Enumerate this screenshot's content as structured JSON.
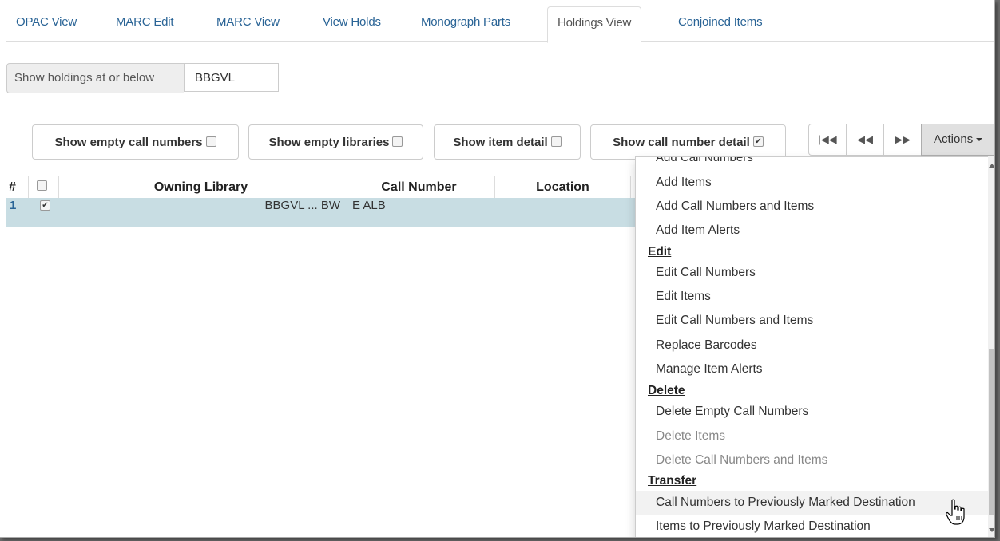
{
  "tabs": [
    {
      "label": "OPAC View"
    },
    {
      "label": "MARC Edit"
    },
    {
      "label": "MARC View"
    },
    {
      "label": "View Holds"
    },
    {
      "label": "Monograph Parts"
    },
    {
      "label": "Holdings View",
      "active": true
    },
    {
      "label": "Conjoined Items"
    }
  ],
  "holdings_filter": {
    "label": "Show holdings at or below",
    "value": "BBGVL"
  },
  "toggles": [
    {
      "label": "Show empty call numbers",
      "checked": false
    },
    {
      "label": "Show empty libraries",
      "checked": false
    },
    {
      "label": "Show item detail",
      "checked": false
    },
    {
      "label": "Show call number detail",
      "checked": true
    }
  ],
  "pager": {
    "first_icon": "first-page-icon",
    "prev_icon": "previous-page-icon",
    "next_icon": "next-page-icon",
    "actions_label": "Actions"
  },
  "grid": {
    "columns": [
      "#",
      "Owning Library",
      "Call Number",
      "Location"
    ],
    "rows": [
      {
        "num": "1",
        "checked": true,
        "owning_library": "BBGVL ... BW",
        "call_number": "E ALB",
        "location": ""
      }
    ]
  },
  "menu": {
    "partial_top": "Add Call Numbers",
    "add_items": [
      "Add Items",
      "Add Call Numbers and Items",
      "Add Item Alerts"
    ],
    "edit_header": "Edit",
    "edit_items": [
      "Edit Call Numbers",
      "Edit Items",
      "Edit Call Numbers and Items",
      "Replace Barcodes",
      "Manage Item Alerts"
    ],
    "delete_header": "Delete",
    "delete_items": [
      "Delete Empty Call Numbers",
      "Delete Items",
      "Delete Call Numbers and Items"
    ],
    "transfer_header": "Transfer",
    "transfer_items": [
      "Call Numbers to Previously Marked Destination",
      "Items to Previously Marked Destination"
    ]
  },
  "colors": {
    "link": "#2a6496",
    "selected_row": "#c8dde3",
    "actions_active": "#e0e0e0"
  }
}
